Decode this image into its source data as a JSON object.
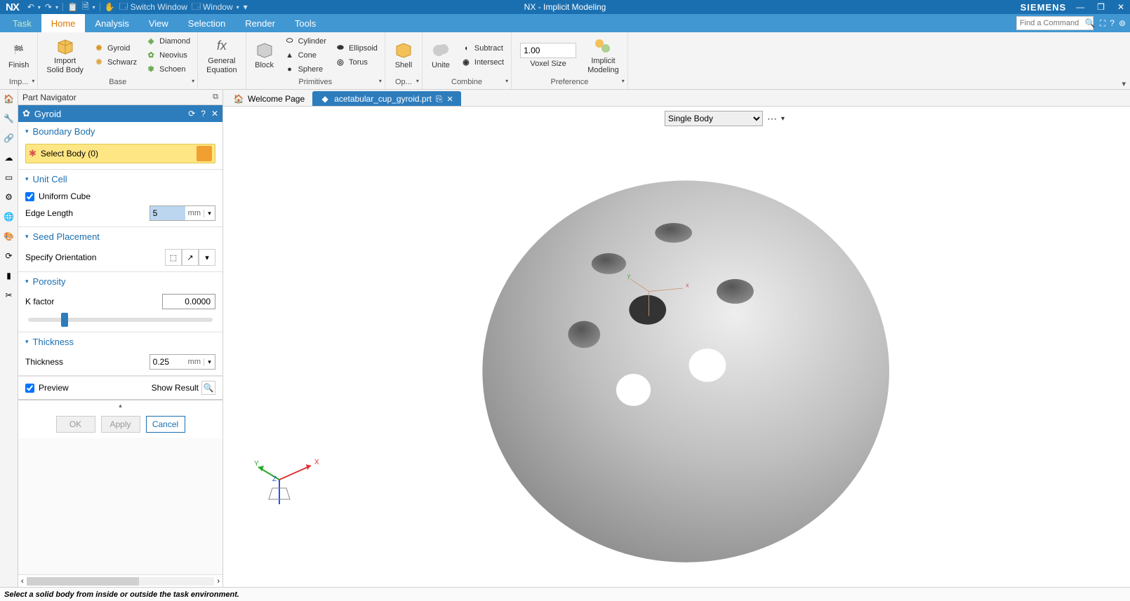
{
  "titlebar": {
    "logo": "NX",
    "qat": {
      "switch_window": "Switch Window",
      "window": "Window"
    },
    "title": "NX - Implicit Modeling",
    "brand": "SIEMENS"
  },
  "menu": {
    "tabs": [
      "Task",
      "Home",
      "Analysis",
      "View",
      "Selection",
      "Render",
      "Tools"
    ],
    "active": "Home",
    "search_placeholder": "Find a Command"
  },
  "ribbon": {
    "finish": "Finish",
    "import": "Import\nSolid Body",
    "base": {
      "label": "Base",
      "items": [
        "Gyroid",
        "Schwarz",
        "Diamond",
        "Neovius",
        "Schoen"
      ]
    },
    "general_equation": "General\nEquation",
    "primitives": {
      "label": "Primitives",
      "block": "Block",
      "items": [
        "Cylinder",
        "Cone",
        "Sphere"
      ],
      "ellipsoid": "Ellipsoid",
      "torus": "Torus"
    },
    "op": {
      "label": "Op...",
      "shell": "Shell"
    },
    "combine": {
      "label": "Combine",
      "unite": "Unite",
      "subtract": "Subtract",
      "intersect": "Intersect"
    },
    "preference": {
      "label": "Preference",
      "voxel_value": "1.00",
      "voxel_label": "Voxel Size",
      "implicit": "Implicit\nModeling"
    },
    "imp": "Imp..."
  },
  "sidebar": {
    "panel_title": "Part Navigator",
    "dialog_title": "Gyroid",
    "sections": {
      "boundary": {
        "title": "Boundary Body",
        "select": "Select Body (0)"
      },
      "unitcell": {
        "title": "Unit Cell",
        "uniform": "Uniform Cube",
        "edge_label": "Edge Length",
        "edge_value": "5",
        "edge_unit": "mm"
      },
      "seed": {
        "title": "Seed Placement",
        "orient": "Specify Orientation"
      },
      "porosity": {
        "title": "Porosity",
        "k_label": "K factor",
        "k_value": "0.0000"
      },
      "thickness": {
        "title": "Thickness",
        "label": "Thickness",
        "value": "0.25",
        "unit": "mm"
      }
    },
    "preview": "Preview",
    "showresult": "Show Result",
    "ok": "OK",
    "apply": "Apply",
    "cancel": "Cancel"
  },
  "tabs": {
    "welcome": "Welcome Page",
    "doc": "acetabular_cup_gyroid.prt"
  },
  "viewport": {
    "filter": "Single Body"
  },
  "status": "Select a solid body from inside or outside the task environment."
}
